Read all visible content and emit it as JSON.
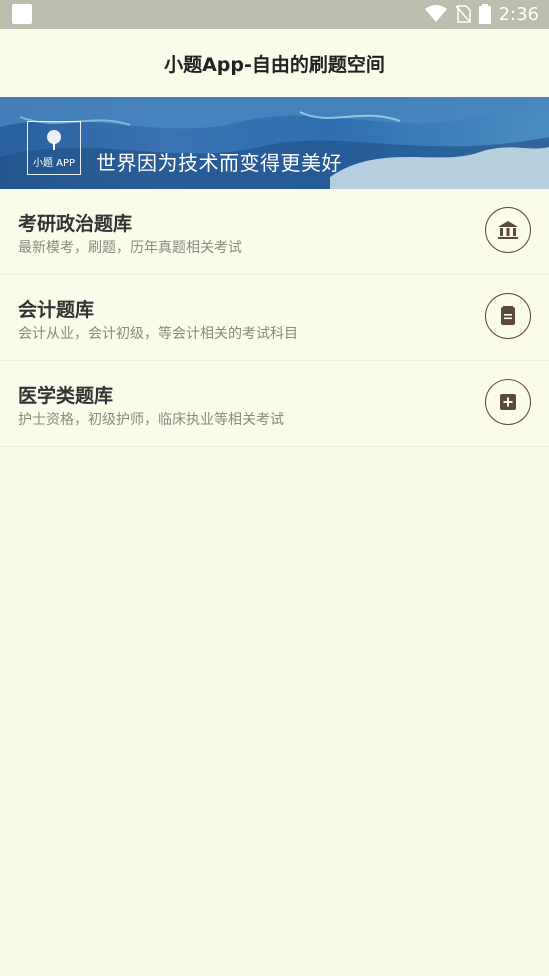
{
  "status": {
    "time": "2:36",
    "icons": [
      "wifi-icon",
      "no-sim-icon",
      "battery-icon"
    ]
  },
  "header": {
    "title": "小题App-自由的刷题空间"
  },
  "banner": {
    "logo_text": "小题 APP",
    "slogan": "世界因为技术而变得更美好"
  },
  "items": [
    {
      "title": "考研政治题库",
      "subtitle": "最新模考，刷题，历年真题相关考试",
      "icon": "bank-icon"
    },
    {
      "title": "会计题库",
      "subtitle": "会计从业，会计初级，等会计相关的考试科目",
      "icon": "notepad-icon"
    },
    {
      "title": "医学类题库",
      "subtitle": "护士资格，初级护师，临床执业等相关考试",
      "icon": "medical-plus-icon"
    }
  ],
  "colors": {
    "background": "#f9f9e8",
    "icon_stroke": "#5b4a3a",
    "banner_blue": "#2f6fb0"
  }
}
